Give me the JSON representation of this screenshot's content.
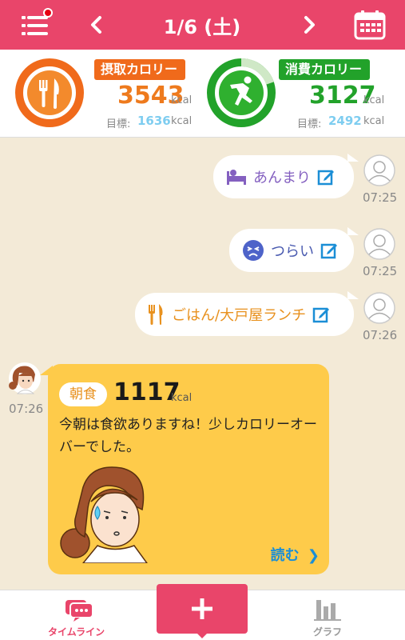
{
  "header": {
    "date": "1/6 (土)"
  },
  "summary": {
    "intake": {
      "label": "摂取カロリー",
      "value": "3543",
      "unit": "kcal",
      "goal_label": "目標:",
      "goal": "1636",
      "goal_unit": "kcal"
    },
    "burn": {
      "label": "消費カロリー",
      "value": "3127",
      "unit": "kcal",
      "goal_label": "目標:",
      "goal": "2492",
      "goal_unit": "kcal"
    }
  },
  "timeline": {
    "entries": [
      {
        "text": "あんまり",
        "time": "07:25"
      },
      {
        "text": "つらい",
        "time": "07:25"
      },
      {
        "text": "ごはん/大戸屋ランチ",
        "time": "07:26"
      }
    ],
    "coach": {
      "time": "07:26",
      "meal": "朝食",
      "kcal": "1117",
      "kcal_unit": "kcal",
      "message": "今朝は食欲ありますね！少しカロリーオーバーでした。",
      "read_more": "読む"
    }
  },
  "bottom_nav": {
    "timeline_label": "タイムライン",
    "graph_label": "グラフ"
  },
  "colors": {
    "brand": "#e9456a",
    "intake": "#f06a1b",
    "burn": "#22a22a",
    "card": "#fecb4a",
    "link": "#1b8ed6"
  },
  "icons": [
    "menu-icon",
    "chevron-left-icon",
    "chevron-right-icon",
    "calendar-icon",
    "fork-knife-icon",
    "running-person-icon",
    "bed-icon",
    "sad-face-icon",
    "edit-icon",
    "user-avatar-icon",
    "coach-avatar",
    "plus-icon",
    "chat-bubble-icon",
    "bar-chart-icon"
  ]
}
